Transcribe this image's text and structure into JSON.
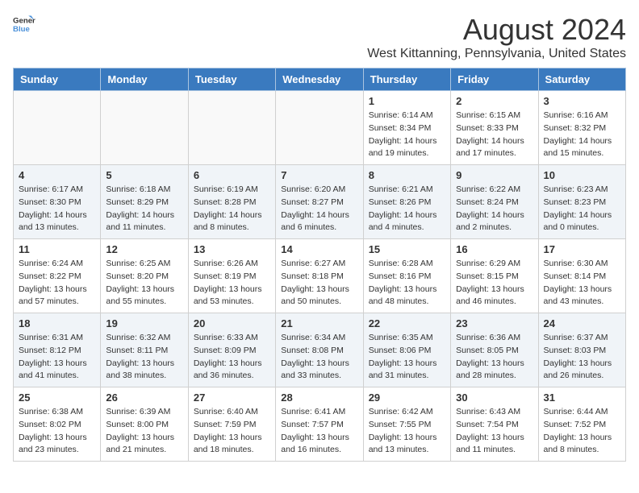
{
  "header": {
    "logo_general": "General",
    "logo_blue": "Blue",
    "title": "August 2024",
    "subtitle": "West Kittanning, Pennsylvania, United States"
  },
  "weekdays": [
    "Sunday",
    "Monday",
    "Tuesday",
    "Wednesday",
    "Thursday",
    "Friday",
    "Saturday"
  ],
  "weeks": [
    [
      {
        "day": "",
        "info": ""
      },
      {
        "day": "",
        "info": ""
      },
      {
        "day": "",
        "info": ""
      },
      {
        "day": "",
        "info": ""
      },
      {
        "day": "1",
        "info": "Sunrise: 6:14 AM\nSunset: 8:34 PM\nDaylight: 14 hours\nand 19 minutes."
      },
      {
        "day": "2",
        "info": "Sunrise: 6:15 AM\nSunset: 8:33 PM\nDaylight: 14 hours\nand 17 minutes."
      },
      {
        "day": "3",
        "info": "Sunrise: 6:16 AM\nSunset: 8:32 PM\nDaylight: 14 hours\nand 15 minutes."
      }
    ],
    [
      {
        "day": "4",
        "info": "Sunrise: 6:17 AM\nSunset: 8:30 PM\nDaylight: 14 hours\nand 13 minutes."
      },
      {
        "day": "5",
        "info": "Sunrise: 6:18 AM\nSunset: 8:29 PM\nDaylight: 14 hours\nand 11 minutes."
      },
      {
        "day": "6",
        "info": "Sunrise: 6:19 AM\nSunset: 8:28 PM\nDaylight: 14 hours\nand 8 minutes."
      },
      {
        "day": "7",
        "info": "Sunrise: 6:20 AM\nSunset: 8:27 PM\nDaylight: 14 hours\nand 6 minutes."
      },
      {
        "day": "8",
        "info": "Sunrise: 6:21 AM\nSunset: 8:26 PM\nDaylight: 14 hours\nand 4 minutes."
      },
      {
        "day": "9",
        "info": "Sunrise: 6:22 AM\nSunset: 8:24 PM\nDaylight: 14 hours\nand 2 minutes."
      },
      {
        "day": "10",
        "info": "Sunrise: 6:23 AM\nSunset: 8:23 PM\nDaylight: 14 hours\nand 0 minutes."
      }
    ],
    [
      {
        "day": "11",
        "info": "Sunrise: 6:24 AM\nSunset: 8:22 PM\nDaylight: 13 hours\nand 57 minutes."
      },
      {
        "day": "12",
        "info": "Sunrise: 6:25 AM\nSunset: 8:20 PM\nDaylight: 13 hours\nand 55 minutes."
      },
      {
        "day": "13",
        "info": "Sunrise: 6:26 AM\nSunset: 8:19 PM\nDaylight: 13 hours\nand 53 minutes."
      },
      {
        "day": "14",
        "info": "Sunrise: 6:27 AM\nSunset: 8:18 PM\nDaylight: 13 hours\nand 50 minutes."
      },
      {
        "day": "15",
        "info": "Sunrise: 6:28 AM\nSunset: 8:16 PM\nDaylight: 13 hours\nand 48 minutes."
      },
      {
        "day": "16",
        "info": "Sunrise: 6:29 AM\nSunset: 8:15 PM\nDaylight: 13 hours\nand 46 minutes."
      },
      {
        "day": "17",
        "info": "Sunrise: 6:30 AM\nSunset: 8:14 PM\nDaylight: 13 hours\nand 43 minutes."
      }
    ],
    [
      {
        "day": "18",
        "info": "Sunrise: 6:31 AM\nSunset: 8:12 PM\nDaylight: 13 hours\nand 41 minutes."
      },
      {
        "day": "19",
        "info": "Sunrise: 6:32 AM\nSunset: 8:11 PM\nDaylight: 13 hours\nand 38 minutes."
      },
      {
        "day": "20",
        "info": "Sunrise: 6:33 AM\nSunset: 8:09 PM\nDaylight: 13 hours\nand 36 minutes."
      },
      {
        "day": "21",
        "info": "Sunrise: 6:34 AM\nSunset: 8:08 PM\nDaylight: 13 hours\nand 33 minutes."
      },
      {
        "day": "22",
        "info": "Sunrise: 6:35 AM\nSunset: 8:06 PM\nDaylight: 13 hours\nand 31 minutes."
      },
      {
        "day": "23",
        "info": "Sunrise: 6:36 AM\nSunset: 8:05 PM\nDaylight: 13 hours\nand 28 minutes."
      },
      {
        "day": "24",
        "info": "Sunrise: 6:37 AM\nSunset: 8:03 PM\nDaylight: 13 hours\nand 26 minutes."
      }
    ],
    [
      {
        "day": "25",
        "info": "Sunrise: 6:38 AM\nSunset: 8:02 PM\nDaylight: 13 hours\nand 23 minutes."
      },
      {
        "day": "26",
        "info": "Sunrise: 6:39 AM\nSunset: 8:00 PM\nDaylight: 13 hours\nand 21 minutes."
      },
      {
        "day": "27",
        "info": "Sunrise: 6:40 AM\nSunset: 7:59 PM\nDaylight: 13 hours\nand 18 minutes."
      },
      {
        "day": "28",
        "info": "Sunrise: 6:41 AM\nSunset: 7:57 PM\nDaylight: 13 hours\nand 16 minutes."
      },
      {
        "day": "29",
        "info": "Sunrise: 6:42 AM\nSunset: 7:55 PM\nDaylight: 13 hours\nand 13 minutes."
      },
      {
        "day": "30",
        "info": "Sunrise: 6:43 AM\nSunset: 7:54 PM\nDaylight: 13 hours\nand 11 minutes."
      },
      {
        "day": "31",
        "info": "Sunrise: 6:44 AM\nSunset: 7:52 PM\nDaylight: 13 hours\nand 8 minutes."
      }
    ]
  ]
}
